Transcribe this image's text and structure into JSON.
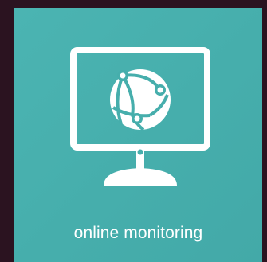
{
  "tile": {
    "label": "online monitoring",
    "icon": "monitor-globe-icon",
    "background_color": "#46aeac",
    "foreground_color": "#ffffff"
  },
  "page": {
    "background_color": "#2b1320"
  }
}
